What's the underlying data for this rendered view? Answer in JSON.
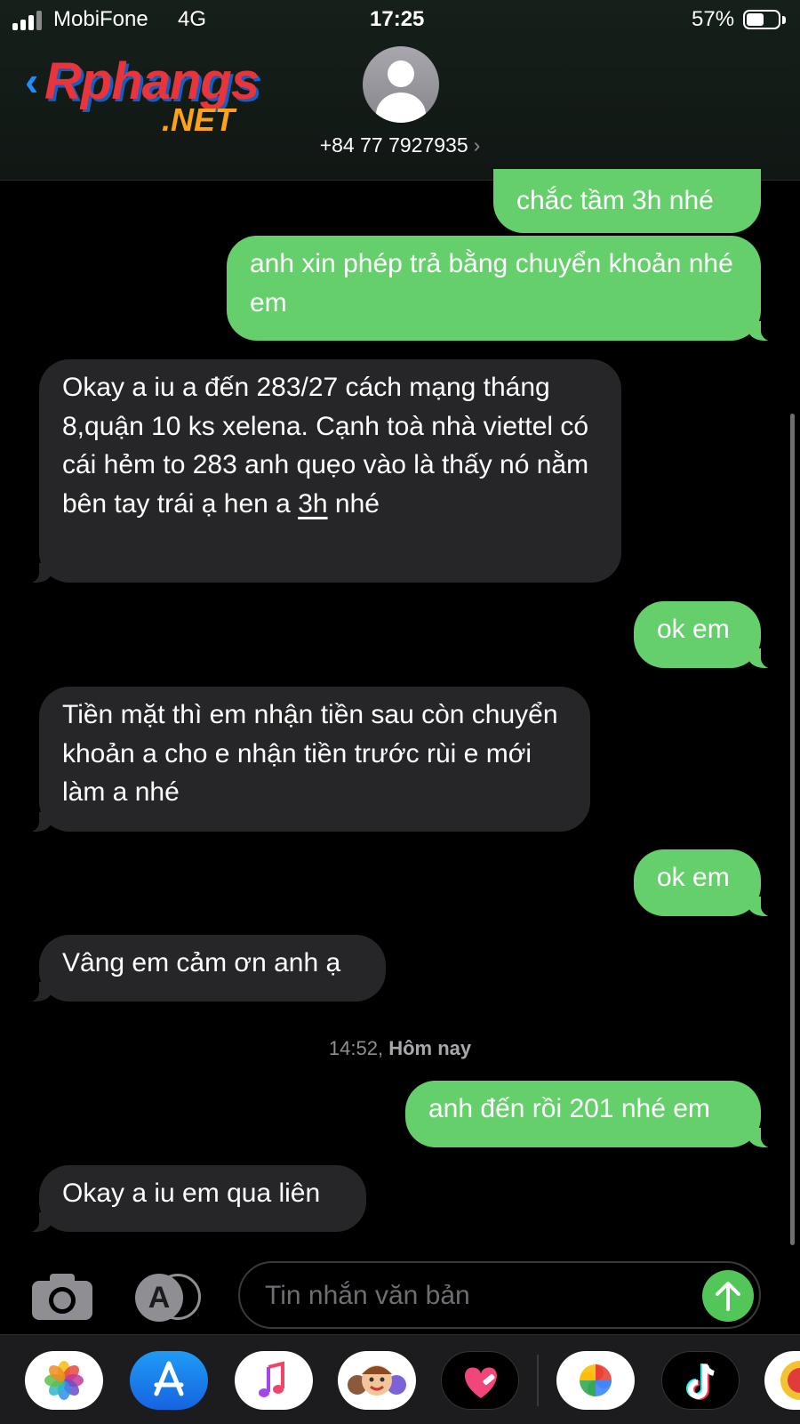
{
  "status_bar": {
    "carrier": "MobiFone",
    "network": "4G",
    "time": "17:25",
    "battery": "57%",
    "battery_level": 0.57
  },
  "header": {
    "back_icon": "chevron-left-icon",
    "watermark_brand": "Rphangs",
    "watermark_domain": ".NET",
    "contact_name": "+84 77 7927935",
    "chevron": "›",
    "avatar_icon": "person-silhouette-icon"
  },
  "messages": [
    {
      "from": "me",
      "text": "chắc tầm 3h nhé"
    },
    {
      "from": "me",
      "text": "anh xin phép trả bằng chuyển khoản nhé em"
    },
    {
      "from": "them",
      "text_before": "Okay a iu a đến 283/27 cách mạng tháng 8,quận 10 ks xelena. Cạnh toà nhà viettel có cái hẻm to 283 anh quẹo vào là thấy nó nằm bên tay trái ạ hen a ",
      "link": "3h",
      "text_after": " nhé"
    },
    {
      "from": "me",
      "text": "ok em"
    },
    {
      "from": "them",
      "text": "Tiền mặt thì em nhận tiền sau còn chuyển khoản a cho e nhận tiền trước rùi e mới làm a nhé"
    },
    {
      "from": "me",
      "text": "ok em"
    },
    {
      "from": "them",
      "text": "Vâng em cảm ơn anh ạ"
    },
    {
      "from": "me",
      "text": "anh đến rồi 201 nhé em"
    },
    {
      "from": "them",
      "text": "Okay a iu em qua liên"
    }
  ],
  "timestamp": {
    "time": "14:52,",
    "day": "Hôm nay"
  },
  "compose": {
    "camera_icon": "camera-icon",
    "apps_icon": "app-store-icon",
    "placeholder": "Tin nhắn văn bản",
    "send_icon": "arrow-up-icon"
  },
  "dock_apps": [
    "photos-icon",
    "app-store-icon",
    "music-icon",
    "memoji-icon",
    "heart-app-icon",
    "google-photos-icon",
    "tiktok-icon",
    "partial-app-icon"
  ],
  "colors": {
    "sent": "#65cf6b",
    "received": "#262628",
    "background": "#000000"
  }
}
